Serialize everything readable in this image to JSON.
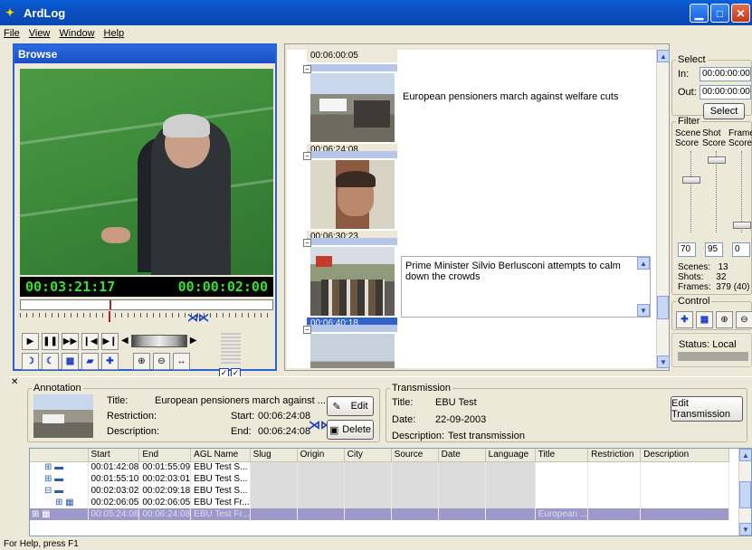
{
  "window": {
    "title": "ArdLog"
  },
  "menu": [
    "File",
    "View",
    "Window",
    "Help"
  ],
  "browse": {
    "title": "Browse",
    "timecode_left": "00:03:21:17",
    "timecode_right": "00:00:02:00"
  },
  "storyboard": {
    "top_timecode": "00:06:00:05",
    "shots": [
      {
        "timecode": "00:06:24:08",
        "description": "European pensioners march against welfare cuts",
        "selected": false
      },
      {
        "timecode": "00:06:30:23",
        "description": "",
        "selected": false
      },
      {
        "timecode": "00:06:40:18",
        "description": "Prime Minister Silvio Berlusconi attempts to calm down the crowds",
        "selected": true
      }
    ]
  },
  "select_panel": {
    "title": "Select",
    "in_label": "In:",
    "in_value": "00:00:00:00",
    "out_label": "Out:",
    "out_value": "00:00:00:00",
    "button": "Select"
  },
  "filter_panel": {
    "title": "Filter",
    "col1": [
      "Scene",
      "Score"
    ],
    "col2": [
      "Shot",
      "Score"
    ],
    "col3": [
      "Frame",
      "Score"
    ],
    "values": [
      "70",
      "95",
      "0"
    ],
    "scenes_label": "Scenes:",
    "scenes_value": "13",
    "shots_label": "Shots:",
    "shots_value": "32",
    "frames_label": "Frames:",
    "frames_value": "379 (40)"
  },
  "control_panel": {
    "title": "Control"
  },
  "status_panel": {
    "text": "Status: Local"
  },
  "annotation": {
    "group_label": "Annotation",
    "title_label": "Title:",
    "title_value": "European pensioners march against ...",
    "restriction_label": "Restriction:",
    "description_label": "Description:",
    "start_label": "Start:",
    "start_value": "00:06:24:08",
    "end_label": "End:",
    "end_value": "00:06:24:08",
    "edit_button": "Edit",
    "delete_button": "Delete"
  },
  "transmission": {
    "group_label": "Transmission",
    "title_label": "Title:",
    "title_value": "EBU Test",
    "date_label": "Date:",
    "date_value": "22-09-2003",
    "description_label": "Description:",
    "description_value": "Test transmission",
    "edit_button": "Edit Transmission"
  },
  "table": {
    "columns": [
      "",
      "Start",
      "End",
      "AGL Name",
      "Slug",
      "Origin",
      "City",
      "Source",
      "Date",
      "Language",
      "Title",
      "Restriction",
      "Description"
    ],
    "rows": [
      {
        "start": "00:01:42:08",
        "end": "00:01:55:09",
        "agl": "EBU Test S...",
        "title": "",
        "selected": false
      },
      {
        "start": "00:01:55:10",
        "end": "00:02:03:01",
        "agl": "EBU Test S...",
        "title": "",
        "selected": false
      },
      {
        "start": "00:02:03:02",
        "end": "00:02:09:18",
        "agl": "EBU Test S...",
        "title": "",
        "selected": false
      },
      {
        "start": "00:02:06:05",
        "end": "00:02:06:05",
        "agl": "EBU Test Fr...",
        "title": "",
        "selected": false
      },
      {
        "start": "00:05:24:08",
        "end": "00:06:24:08",
        "agl": "EBU Test Fr...",
        "title": "European ...",
        "selected": true
      }
    ]
  },
  "statusbar": {
    "text": "For Help, press F1"
  }
}
